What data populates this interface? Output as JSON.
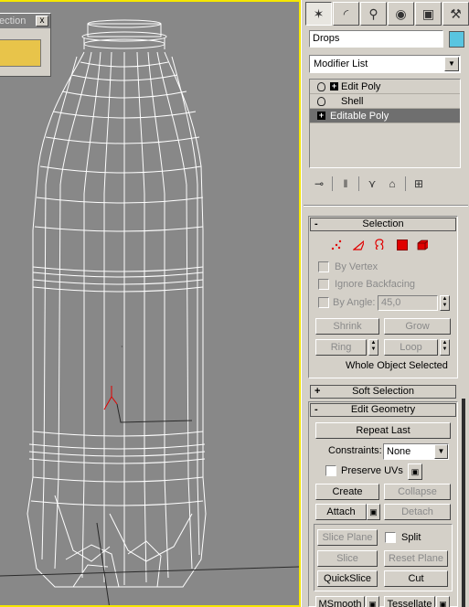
{
  "floater": {
    "title": "ection",
    "close_label": "x"
  },
  "tabs": [
    {
      "icon": "create-icon",
      "glyph": "✶"
    },
    {
      "icon": "modify-icon",
      "glyph": "◜"
    },
    {
      "icon": "hierarchy-icon",
      "glyph": "⚲"
    },
    {
      "icon": "motion-icon",
      "glyph": "◉"
    },
    {
      "icon": "display-icon",
      "glyph": "▣"
    },
    {
      "icon": "utilities-icon",
      "glyph": "⚒"
    }
  ],
  "object": {
    "name": "Drops",
    "color": "#59c5e0"
  },
  "modifier_list": {
    "label": "Modifier List"
  },
  "stack": [
    {
      "label": "Edit Poly",
      "expandable": true,
      "bulb": true
    },
    {
      "label": "Shell",
      "expandable": false,
      "bulb": true
    },
    {
      "label": "Editable Poly",
      "expandable": true,
      "bulb": false,
      "selected": true
    }
  ],
  "selection": {
    "title": "Selection",
    "by_vertex": "By Vertex",
    "ignore_backfacing": "Ignore Backfacing",
    "by_angle": "By Angle:",
    "angle_value": "45,0",
    "shrink": "Shrink",
    "grow": "Grow",
    "ring": "Ring",
    "loop": "Loop",
    "status": "Whole Object Selected"
  },
  "soft_selection": {
    "title": "Soft Selection"
  },
  "edit_geometry": {
    "title": "Edit Geometry",
    "repeat_last": "Repeat Last",
    "constraints_label": "Constraints:",
    "constraints_value": "None",
    "preserve_uvs": "Preserve UVs",
    "create": "Create",
    "collapse": "Collapse",
    "attach": "Attach",
    "detach": "Detach",
    "slice_plane": "Slice Plane",
    "split": "Split",
    "slice": "Slice",
    "reset_plane": "Reset Plane",
    "quickslice": "QuickSlice",
    "cut": "Cut",
    "msmooth": "MSmooth",
    "tessellate": "Tessellate"
  },
  "colors": {
    "viewport_bg": "#888888",
    "viewport_border": "#f5e600",
    "panel_bg": "#d4d0c8",
    "wire": "#ffffff",
    "selection_red": "#e00000"
  }
}
